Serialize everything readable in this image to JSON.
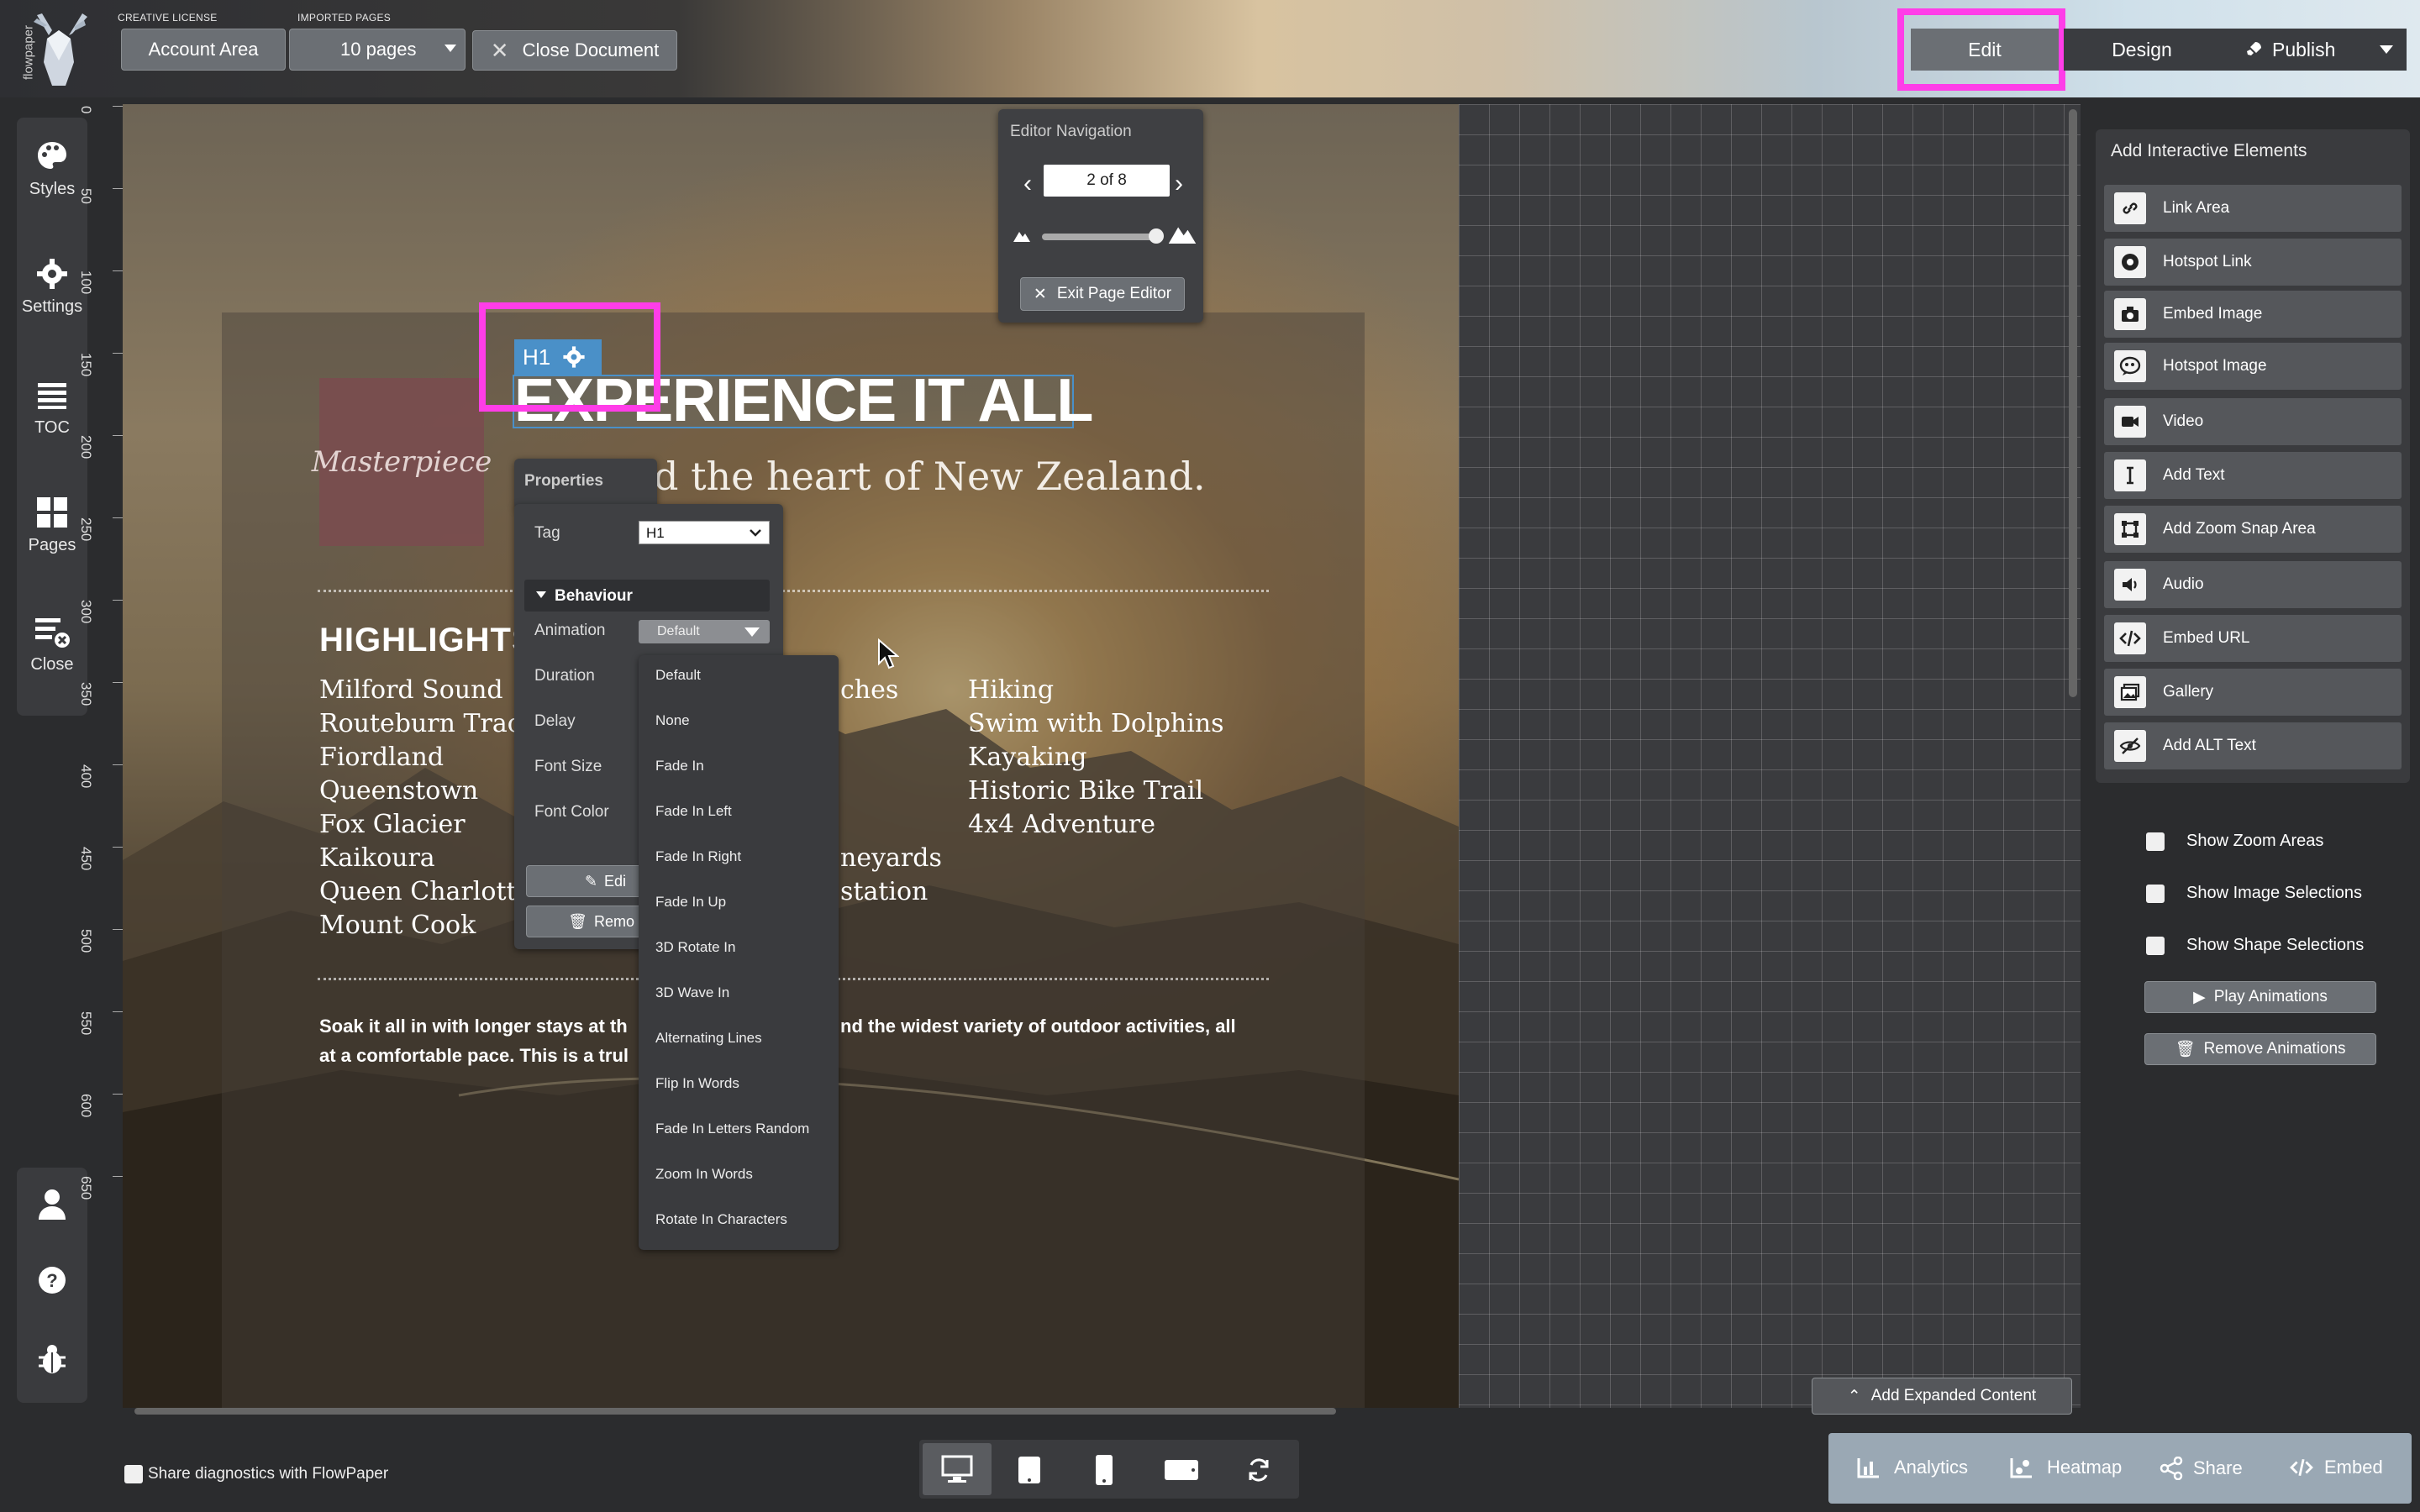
{
  "topbar": {
    "brand": "flowpaper",
    "license_label": "CREATIVE LICENSE",
    "account_button": "Account Area",
    "imported_label": "IMPORTED PAGES",
    "pages_select": "10 pages",
    "close_document": "Close Document",
    "modes": [
      {
        "label": "Edit"
      },
      {
        "label": "Design"
      },
      {
        "label": "Publish"
      }
    ]
  },
  "sidebar": {
    "items": [
      {
        "label": "Styles",
        "icon": "palette-icon"
      },
      {
        "label": "Settings",
        "icon": "gear-icon"
      },
      {
        "label": "TOC",
        "icon": "list-icon"
      },
      {
        "label": "Pages",
        "icon": "grid-icon"
      },
      {
        "label": "Close",
        "icon": "close-doc-icon"
      }
    ],
    "bottom_icons": [
      "user-icon",
      "help-icon",
      "bug-icon"
    ]
  },
  "ruler": {
    "ticks": [
      "0",
      "50",
      "100",
      "150",
      "200",
      "250",
      "300",
      "350",
      "400",
      "450",
      "500",
      "550",
      "600",
      "650"
    ]
  },
  "editor_nav": {
    "title": "Editor Navigation",
    "page_indicator": "2 of 8",
    "exit_button": "Exit Page Editor",
    "zoom_level": 0.97
  },
  "page": {
    "logo_text": "Masterpiece",
    "element_tag": "H1",
    "headline": "EXPERIENCE IT ALL",
    "subheadline_visible": "d the heart of New Zealand.",
    "highlights_title": "HIGHLIGHTS",
    "col1": [
      "Milford Sound",
      "Routeburn Trac",
      "Fiordland",
      "Queenstown",
      "Fox Glacier",
      "Kaikoura",
      "Queen Charlott",
      "Mount Cook"
    ],
    "col2_fragments": [
      "ches",
      "neyards",
      "station"
    ],
    "col3": [
      "Hiking",
      "Swim with Dolphins",
      "Kayaking",
      "Historic Bike Trail",
      "4x4 Adventure"
    ],
    "para_left_1": "Soak it all in with longer stays at th",
    "para_right_1": "nd the widest variety of outdoor activities, all",
    "para_left_2": "at a comfortable pace. This is a trul"
  },
  "properties": {
    "title": "Properties",
    "tag_label": "Tag",
    "tag_value": "H1",
    "behaviour_label": "Behaviour",
    "rows": [
      "Animation",
      "Duration",
      "Delay",
      "Font Size",
      "Font Color"
    ],
    "animation_value": "Default",
    "edit_button": "Edi",
    "remove_button": "Remo"
  },
  "animation_dropdown": {
    "options": [
      "Default",
      "None",
      "Fade In",
      "Fade In Left",
      "Fade In Right",
      "Fade In Up",
      "3D Rotate In",
      "3D Wave In",
      "Alternating Lines",
      "Flip In Words",
      "Fade In Letters Random",
      "Zoom In Words",
      "Rotate In Characters"
    ]
  },
  "right_panel": {
    "title": "Add Interactive Elements",
    "items": [
      {
        "label": "Link Area",
        "icon": "link-icon"
      },
      {
        "label": "Hotspot Link",
        "icon": "hotspot-icon"
      },
      {
        "label": "Embed Image",
        "icon": "camera-icon"
      },
      {
        "label": "Hotspot Image",
        "icon": "hotspot-image-icon"
      },
      {
        "label": "Video",
        "icon": "video-icon"
      },
      {
        "label": "Add Text",
        "icon": "text-cursor-icon"
      },
      {
        "label": "Add Zoom Snap Area",
        "icon": "zoom-area-icon"
      },
      {
        "label": "Audio",
        "icon": "audio-icon"
      },
      {
        "label": "Embed URL",
        "icon": "code-icon"
      },
      {
        "label": "Gallery",
        "icon": "gallery-icon"
      },
      {
        "label": "Add ALT Text",
        "icon": "alt-text-icon"
      }
    ],
    "checkboxes": [
      "Show Zoom Areas",
      "Show Image Selections",
      "Show Shape Selections"
    ],
    "play_button": "Play Animations",
    "remove_button": "Remove Animations"
  },
  "canvas": {
    "expanded_button": "Add Expanded Content"
  },
  "footer": {
    "diagnostics": "Share diagnostics with FlowPaper",
    "devices": [
      "desktop-icon",
      "tablet-icon",
      "phone-icon",
      "landscape-icon",
      "refresh-icon"
    ],
    "actions": [
      {
        "label": "Analytics",
        "icon": "analytics-icon"
      },
      {
        "label": "Heatmap",
        "icon": "heatmap-icon"
      },
      {
        "label": "Share",
        "icon": "share-icon"
      },
      {
        "label": "Embed",
        "icon": "embed-icon"
      }
    ]
  },
  "colors": {
    "highlight": "#ff3de8",
    "selection": "#4a90c8"
  }
}
